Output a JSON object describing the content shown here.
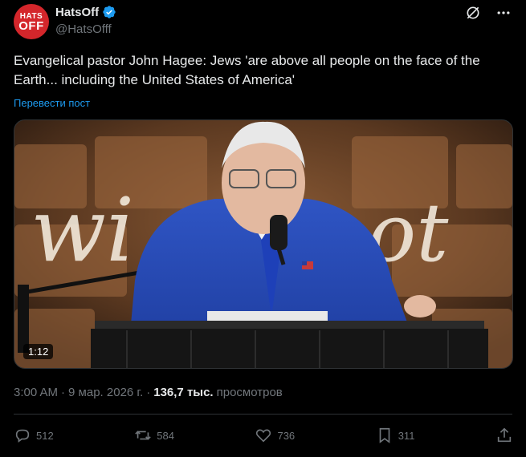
{
  "author": {
    "avatar_line1": "HATS",
    "avatar_line2": "OFF",
    "name": "HatsOff",
    "handle": "@HatsOfff"
  },
  "tweet": {
    "text": "Evangelical pastor John Hagee: Jews 'are above all people on the face of the Earth... including the United States of America'",
    "translate_link": "Перевести пост"
  },
  "media": {
    "duration": "1:12",
    "backdrop_text": "without"
  },
  "meta": {
    "time": "3:00 AM",
    "sep1": "·",
    "date": "9 мар. 2026 г.",
    "sep2": "·",
    "views_count": "136,7 тыс.",
    "views_label": "просмотров"
  },
  "actions": {
    "replies": "512",
    "reposts": "584",
    "likes": "736",
    "bookmarks": "311"
  },
  "colors": {
    "background": "#000000",
    "link": "#1d9bf0",
    "muted": "#71767b",
    "text": "#e7e9ea",
    "verified": "#1d9bf0"
  }
}
